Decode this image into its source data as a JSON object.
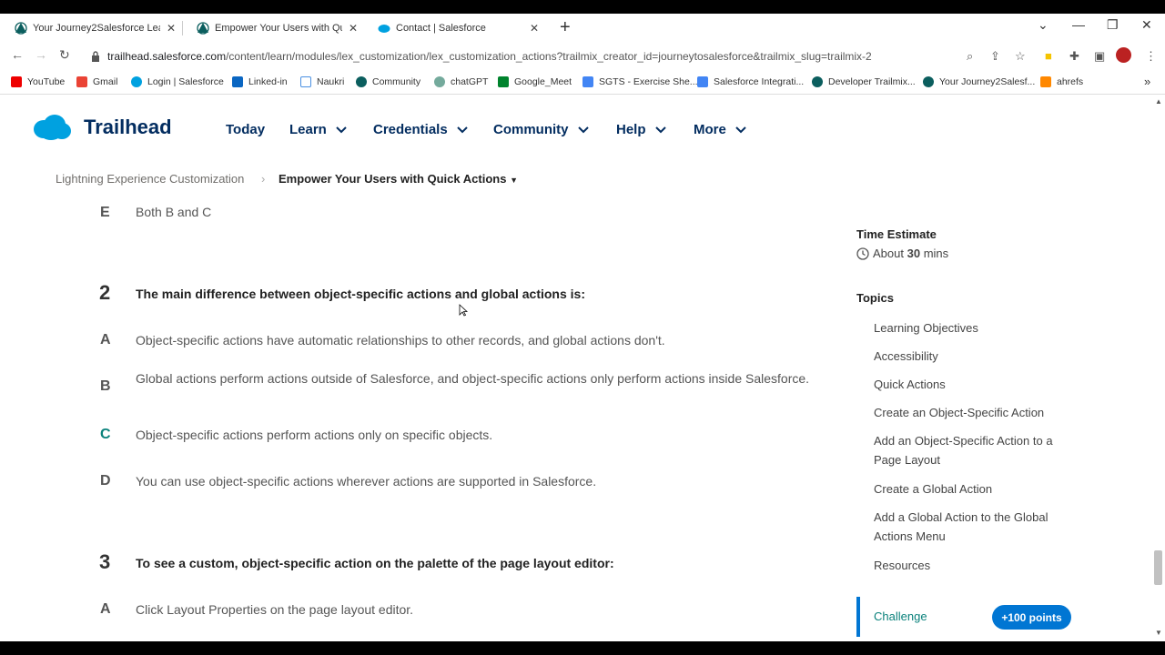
{
  "browser": {
    "tabs": [
      {
        "title": "Your Journey2Salesforce Learnin",
        "active": false
      },
      {
        "title": "Empower Your Users with Quick",
        "active": false
      },
      {
        "title": "Contact | Salesforce",
        "active": true
      }
    ],
    "url_domain": "trailhead.salesforce.com",
    "url_path": "/content/learn/modules/lex_customization/lex_customization_actions?trailmix_creator_id=journeytosalesforce&trailmix_slug=trailmix-2",
    "bookmarks": [
      "YouTube",
      "Gmail",
      "Login | Salesforce",
      "Linked-in",
      "Naukri",
      "Community",
      "chatGPT",
      "Google_Meet",
      "SGTS - Exercise She...",
      "Salesforce Integrati...",
      "Developer Trailmix...",
      "Your Journey2Salesf...",
      "ahrefs"
    ]
  },
  "header": {
    "logo": "Trailhead",
    "nav": [
      "Today",
      "Learn",
      "Credentials",
      "Community",
      "Help",
      "More"
    ]
  },
  "breadcrumb": {
    "parent": "Lightning Experience Customization",
    "current": "Empower Your Users with Quick Actions"
  },
  "content": {
    "prev_option": {
      "letter": "E",
      "text": "Both B and C"
    },
    "q2": {
      "number": "2",
      "text": "The main difference between object-specific actions and global actions is:",
      "options": [
        {
          "letter": "A",
          "text": "Object-specific actions have automatic relationships to other records, and global actions don't."
        },
        {
          "letter": "B",
          "text": "Global actions perform actions outside of Salesforce, and object-specific actions only perform actions inside Salesforce."
        },
        {
          "letter": "C",
          "text": "Object-specific actions perform actions only on specific objects."
        },
        {
          "letter": "D",
          "text": "You can use object-specific actions wherever actions are supported in Salesforce."
        }
      ]
    },
    "q3": {
      "number": "3",
      "text": "To see a custom, object-specific action on the palette of the page layout editor:",
      "options": [
        {
          "letter": "A",
          "text": "Click Layout Properties on the page layout editor."
        }
      ]
    }
  },
  "sidebar": {
    "time_heading": "Time Estimate",
    "time_prefix": "About",
    "time_value": "30",
    "time_suffix": "mins",
    "topics_heading": "Topics",
    "topics": [
      "Learning Objectives",
      "Accessibility",
      "Quick Actions",
      "Create an Object-Specific Action",
      "Add an Object-Specific Action to a Page Layout",
      "Create a Global Action",
      "Add a Global Action to the Global Actions Menu",
      "Resources",
      "Challenge"
    ],
    "points_badge": "+100 points"
  },
  "colors": {
    "brand": "#032d60",
    "accent": "#0176d3",
    "challenge": "#0b827c"
  }
}
